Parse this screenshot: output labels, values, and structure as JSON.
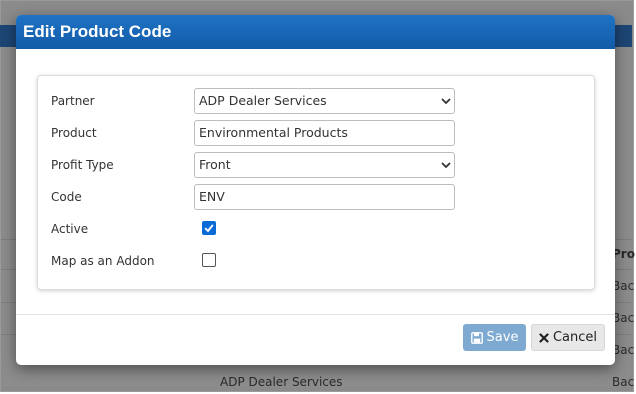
{
  "modal": {
    "title": "Edit Product Code",
    "fields": {
      "partner": {
        "label": "Partner",
        "value": "ADP Dealer Services"
      },
      "product": {
        "label": "Product",
        "value": "Environmental Products"
      },
      "profit_type": {
        "label": "Profit Type",
        "value": "Front"
      },
      "code": {
        "label": "Code",
        "value": "ENV"
      },
      "active": {
        "label": "Active",
        "checked": true
      },
      "addon": {
        "label": "Map as an Addon",
        "checked": false
      }
    },
    "buttons": {
      "save": "Save",
      "cancel": "Cancel"
    }
  },
  "background": {
    "col_header": "Pro",
    "row_cells": [
      "Bac",
      "Bac",
      "Bac",
      "Bac"
    ],
    "bottom_text": "ADP Dealer Services"
  },
  "colors": {
    "header_blue": "#1b67b5",
    "checkbox_blue": "#0b6bd6",
    "save_button": "#7ea9d0"
  }
}
